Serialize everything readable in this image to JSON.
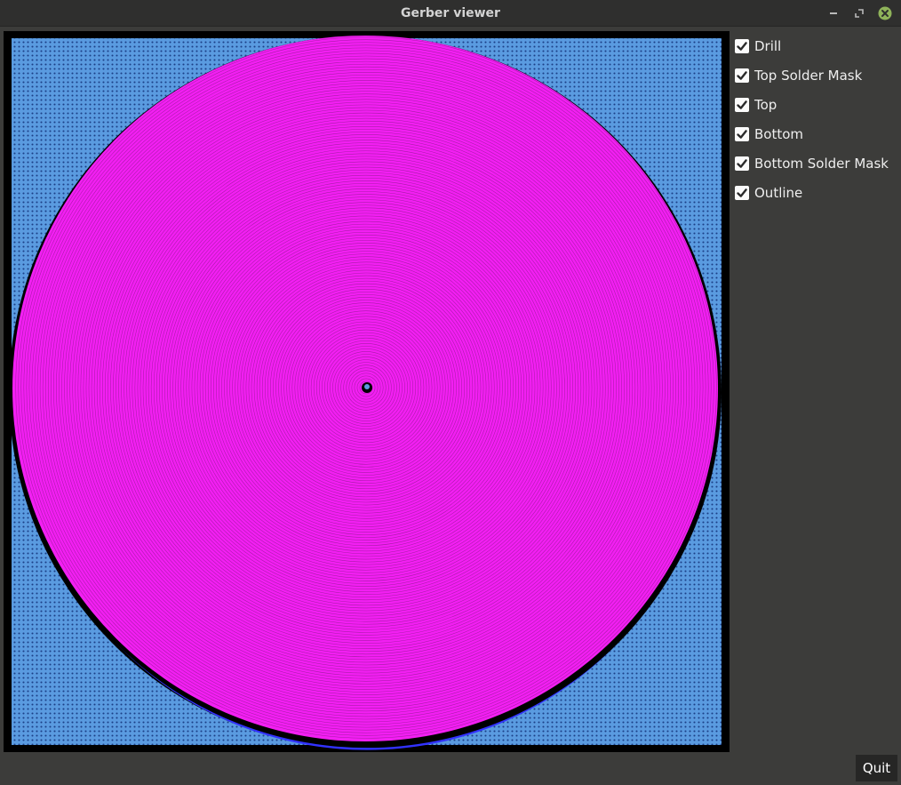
{
  "window": {
    "title": "Gerber viewer"
  },
  "layers": [
    {
      "label": "Drill",
      "checked": true
    },
    {
      "label": "Top Solder Mask",
      "checked": true
    },
    {
      "label": "Top",
      "checked": true
    },
    {
      "label": "Bottom",
      "checked": true
    },
    {
      "label": "Bottom Solder Mask",
      "checked": true
    },
    {
      "label": "Outline",
      "checked": true
    }
  ],
  "buttons": {
    "quit_label": "Quit"
  },
  "colors": {
    "background_copper": "#5a9be0",
    "via_dot": "#0f2a6b",
    "top_copper": "#f21ff2",
    "bottom_copper": "#3232ff",
    "outline": "#000000",
    "close_button": "#8fb35a"
  },
  "icons": {
    "minimize": "minimize-icon",
    "maximize": "maximize-icon",
    "close": "close-icon",
    "checkbox": "checkmark-icon"
  }
}
